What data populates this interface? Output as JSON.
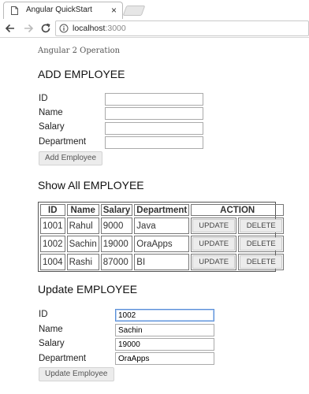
{
  "browser": {
    "tab_title": "Angular QuickStart",
    "close_glyph": "×",
    "url_host": "localhost",
    "url_port": ":3000"
  },
  "page": {
    "title": "Angular 2 Operation"
  },
  "add_section": {
    "heading": "ADD EMPLOYEE",
    "labels": [
      "ID",
      "Name",
      "Salary",
      "Department"
    ],
    "values": [
      "",
      "",
      "",
      ""
    ],
    "button": "Add Employee"
  },
  "list_section": {
    "heading": "Show All EMPLOYEE",
    "columns": [
      "ID",
      "Name",
      "Salary",
      "Department",
      "ACTION"
    ],
    "rows": [
      [
        "1001",
        "Rahul",
        "9000",
        "Java"
      ],
      [
        "1002",
        "Sachin",
        "19000",
        "OraApps"
      ],
      [
        "1004",
        "Rashi",
        "87000",
        "BI"
      ]
    ],
    "update_label": "UPDATE",
    "delete_label": "DELETE"
  },
  "update_section": {
    "heading": "Update EMPLOYEE",
    "labels": [
      "ID",
      "Name",
      "Salary",
      "Department"
    ],
    "values": [
      "1002",
      "Sachin",
      "19000",
      "OraApps"
    ],
    "button": "Update Employee"
  }
}
